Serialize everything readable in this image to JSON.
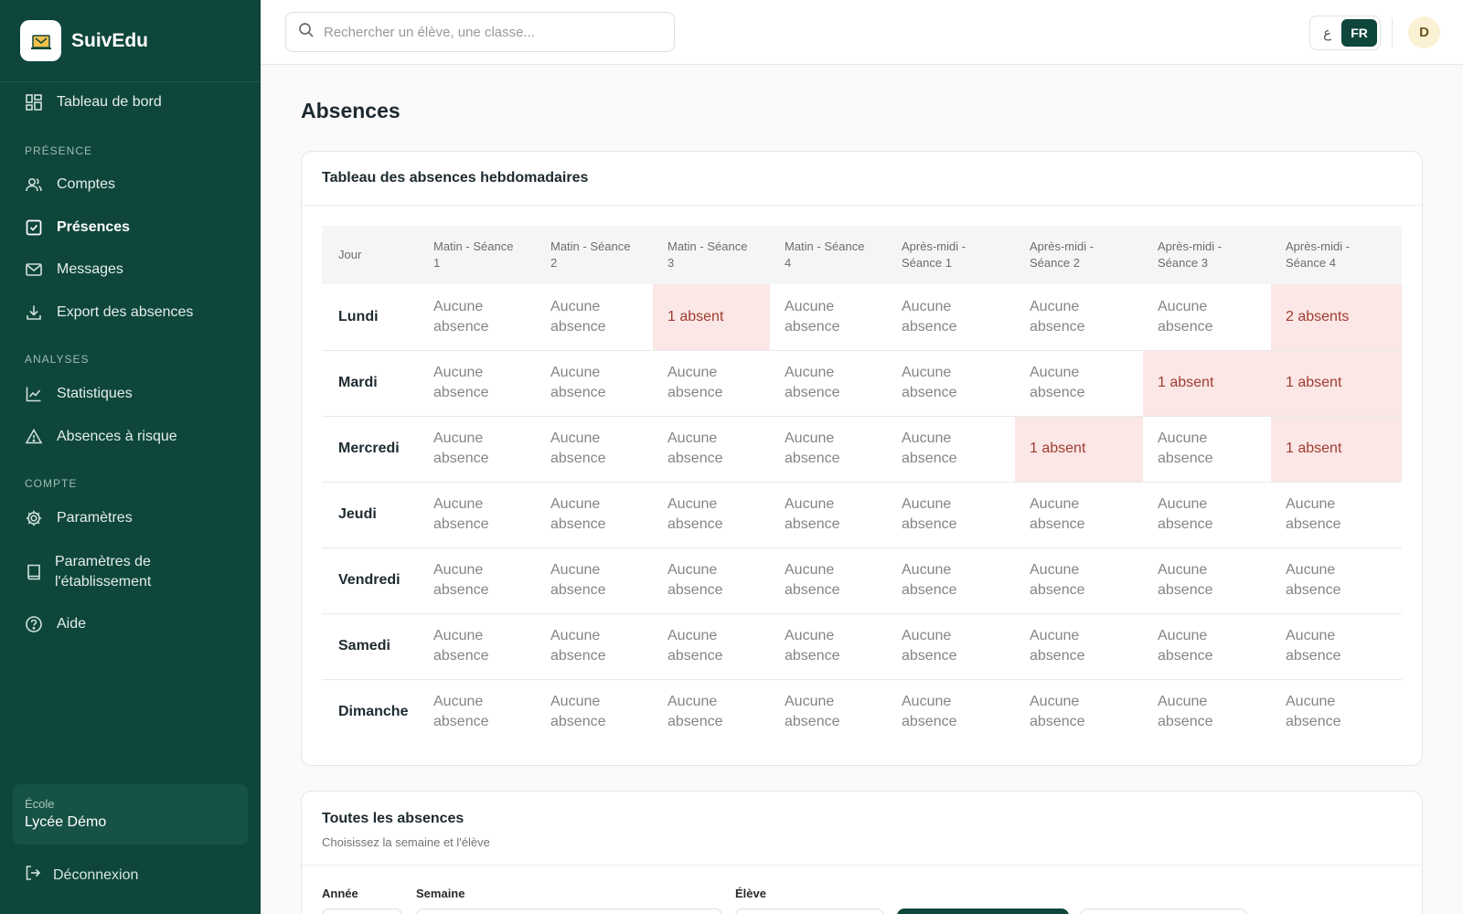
{
  "app": {
    "name": "SuivEdu"
  },
  "sidebar": {
    "dashboard": "Tableau de bord",
    "sections": {
      "presence": "PRÉSENCE",
      "analyses": "ANALYSES",
      "account": "COMPTE"
    },
    "items": {
      "accounts": "Comptes",
      "attendance": "Présences",
      "messages": "Messages",
      "export": "Export des absences",
      "stats": "Statistiques",
      "risk": "Absences à risque",
      "settings": "Paramètres",
      "school_settings_1": "Paramètres de",
      "school_settings_2": "l'établissement",
      "help": "Aide"
    },
    "school": {
      "caption": "École",
      "name": "Lycée Démo"
    },
    "logout": "Déconnexion"
  },
  "topbar": {
    "search_placeholder": "Rechercher un élève, une classe...",
    "lang_ar": "ع",
    "lang_fr": "FR",
    "avatar_initial": "D"
  },
  "page": {
    "title": "Absences"
  },
  "weekly": {
    "title": "Tableau des absences hebdomadaires",
    "columns": [
      "Jour",
      "Matin - Séance 1",
      "Matin - Séance 2",
      "Matin - Séance 3",
      "Matin - Séance 4",
      "Après-midi - Séance 1",
      "Après-midi - Séance 2",
      "Après-midi - Séance 3",
      "Après-midi - Séance 4"
    ],
    "rows": [
      {
        "day": "Lundi",
        "cells": [
          "Aucune absence",
          "Aucune absence",
          "1 absent",
          "Aucune absence",
          "Aucune absence",
          "Aucune absence",
          "Aucune absence",
          "2 absents"
        ]
      },
      {
        "day": "Mardi",
        "cells": [
          "Aucune absence",
          "Aucune absence",
          "Aucune absence",
          "Aucune absence",
          "Aucune absence",
          "Aucune absence",
          "1 absent",
          "1 absent"
        ]
      },
      {
        "day": "Mercredi",
        "cells": [
          "Aucune absence",
          "Aucune absence",
          "Aucune absence",
          "Aucune absence",
          "Aucune absence",
          "1 absent",
          "Aucune absence",
          "1 absent"
        ]
      },
      {
        "day": "Jeudi",
        "cells": [
          "Aucune absence",
          "Aucune absence",
          "Aucune absence",
          "Aucune absence",
          "Aucune absence",
          "Aucune absence",
          "Aucune absence",
          "Aucune absence"
        ]
      },
      {
        "day": "Vendredi",
        "cells": [
          "Aucune absence",
          "Aucune absence",
          "Aucune absence",
          "Aucune absence",
          "Aucune absence",
          "Aucune absence",
          "Aucune absence",
          "Aucune absence"
        ]
      },
      {
        "day": "Samedi",
        "cells": [
          "Aucune absence",
          "Aucune absence",
          "Aucune absence",
          "Aucune absence",
          "Aucune absence",
          "Aucune absence",
          "Aucune absence",
          "Aucune absence"
        ]
      },
      {
        "day": "Dimanche",
        "cells": [
          "Aucune absence",
          "Aucune absence",
          "Aucune absence",
          "Aucune absence",
          "Aucune absence",
          "Aucune absence",
          "Aucune absence",
          "Aucune absence"
        ]
      }
    ]
  },
  "all_absences": {
    "title": "Toutes les absences",
    "subtitle": "Choisissez la semaine et l'élève",
    "filters": {
      "year": "Année",
      "week": "Semaine",
      "student": "Élève"
    }
  },
  "colors": {
    "sidebar": "#0e463b",
    "accent": "#0e463b",
    "absent_bg": "#fbe7e5",
    "absent_text": "#a03b30"
  }
}
